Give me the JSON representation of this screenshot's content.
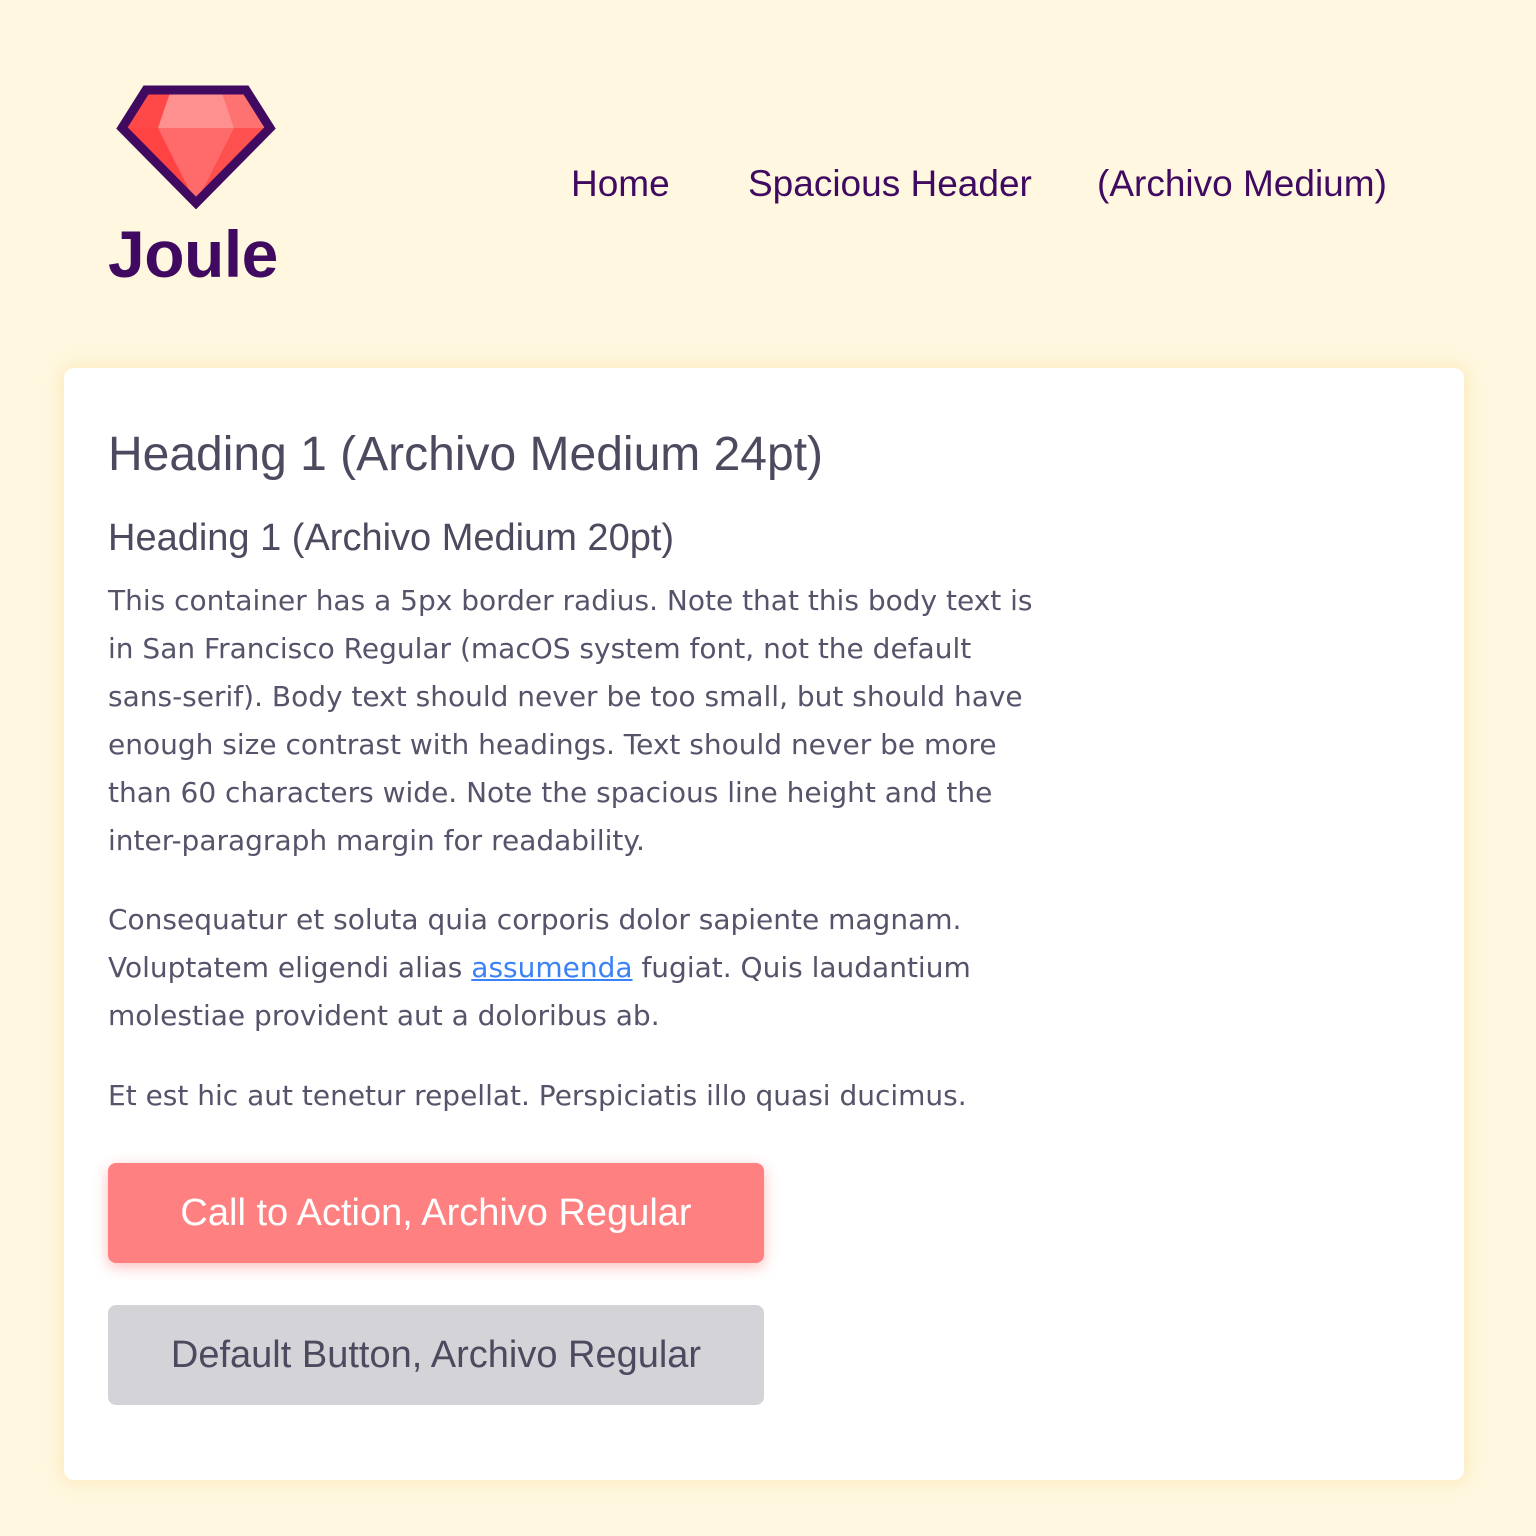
{
  "brand": {
    "name": "Joule",
    "logo_icon": "gem-icon",
    "colors": {
      "brand_purple": "#3f0a60",
      "gem_red": "#ff6b6b",
      "page_background": "#fff7df",
      "cta_background": "#ff8080",
      "default_button_background": "#d4d3d8",
      "link_blue": "#3b82f6",
      "heading_text": "#4b4a5e"
    }
  },
  "nav": {
    "items": [
      {
        "label": "Home"
      },
      {
        "label": "Spacious Header"
      },
      {
        "label": "(Archivo Medium)"
      }
    ]
  },
  "content": {
    "heading1": "Heading 1 (Archivo Medium 24pt)",
    "heading2": "Heading 1 (Archivo Medium 20pt)",
    "paragraph1": [
      "This container has a 5px border radius. Note that this body text is",
      "in San Francisco Regular (macOS system font, not the default",
      "sans-serif). Body text should never be too small, but should have",
      "enough size contrast with headings. Text should never be more",
      "than 60 characters wide. Note the spacious line height and the",
      "inter-paragraph margin for readability."
    ],
    "paragraph2": {
      "line1": "Consequatur et soluta quia corporis dolor sapiente magnam.",
      "line2_before_link": "Voluptatem eligendi alias ",
      "link_text": "assumenda",
      "line2_after_link": " fugiat. Quis laudantium",
      "line3": "molestiae provident aut a doloribus ab."
    },
    "paragraph3": "Et est hic aut tenetur repellat. Perspiciatis illo quasi ducimus."
  },
  "buttons": {
    "cta_label": "Call to Action, Archivo Regular",
    "default_label": "Default Button, Archivo Regular"
  }
}
